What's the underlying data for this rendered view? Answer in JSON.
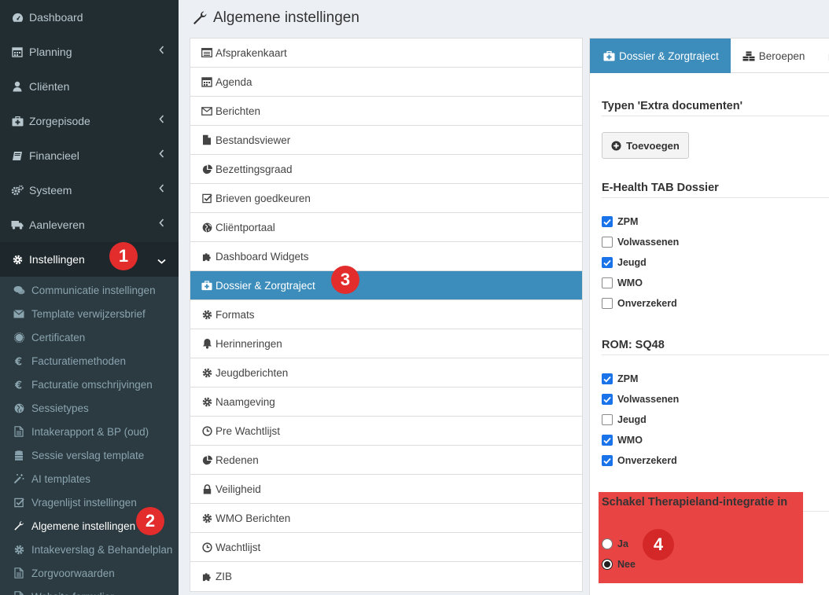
{
  "sidebar": {
    "nav": [
      {
        "label": "Dashboard",
        "icon": "dashboard-icon",
        "chevron": false
      },
      {
        "label": "Planning",
        "icon": "calendar-icon",
        "chevron": true
      },
      {
        "label": "Cliënten",
        "icon": "user-icon",
        "chevron": false
      },
      {
        "label": "Zorgepisode",
        "icon": "medkit-icon",
        "chevron": true
      },
      {
        "label": "Financieel",
        "icon": "book-icon",
        "chevron": true
      },
      {
        "label": "Systeem",
        "icon": "cogs-icon",
        "chevron": true
      },
      {
        "label": "Aanleveren",
        "icon": "truck-icon",
        "chevron": true
      },
      {
        "label": "Instellingen",
        "icon": "gear-icon",
        "chevron": true,
        "active": true
      }
    ],
    "sub": [
      {
        "label": "Communicatie instellingen",
        "icon": "comments-icon"
      },
      {
        "label": "Template verwijzersbrief",
        "icon": "envelope-icon"
      },
      {
        "label": "Certificaten",
        "icon": "certificate-icon"
      },
      {
        "label": "Facturatiemethoden",
        "icon": "euro-icon"
      },
      {
        "label": "Facturatie omschrijvingen",
        "icon": "euro-icon"
      },
      {
        "label": "Sessietypes",
        "icon": "globe-icon"
      },
      {
        "label": "Intakerapport & BP (oud)",
        "icon": "file-icon"
      },
      {
        "label": "Sessie verslag template",
        "icon": "database-icon"
      },
      {
        "label": "AI templates",
        "icon": "magic-wand-icon"
      },
      {
        "label": "Vragenlijst instellingen",
        "icon": "checkbox-icon"
      },
      {
        "label": "Algemene instellingen",
        "icon": "wrench-icon",
        "active": true
      },
      {
        "label": "Intakeverslag & Behandelplan",
        "icon": "gear-icon"
      },
      {
        "label": "Zorgvoorwaarden",
        "icon": "file-icon"
      },
      {
        "label": "Website formulier",
        "icon": "file-icon"
      }
    ]
  },
  "page": {
    "title": "Algemene instellingen"
  },
  "badges": [
    "1",
    "2",
    "3",
    "4"
  ],
  "settings_list": [
    {
      "label": "Afsprakenkaart",
      "icon": "list-alt-icon"
    },
    {
      "label": "Agenda",
      "icon": "calendar-icon"
    },
    {
      "label": "Berichten",
      "icon": "envelope-icon"
    },
    {
      "label": "Bestandsviewer",
      "icon": "file-icon"
    },
    {
      "label": "Bezettingsgraad",
      "icon": "pie-chart-icon"
    },
    {
      "label": "Brieven goedkeuren",
      "icon": "checkbox-icon"
    },
    {
      "label": "Cliëntportaal",
      "icon": "globe-icon"
    },
    {
      "label": "Dashboard Widgets",
      "icon": "puzzle-icon"
    },
    {
      "label": "Dossier & Zorgtraject",
      "icon": "medkit-icon",
      "active": true
    },
    {
      "label": "Formats",
      "icon": "gear-icon"
    },
    {
      "label": "Herinneringen",
      "icon": "bell-icon"
    },
    {
      "label": "Jeugdberichten",
      "icon": "gear-icon"
    },
    {
      "label": "Naamgeving",
      "icon": "gear-icon"
    },
    {
      "label": "Pre Wachtlijst",
      "icon": "clock-icon"
    },
    {
      "label": "Redenen",
      "icon": "pie-chart-icon"
    },
    {
      "label": "Veiligheid",
      "icon": "lock-icon"
    },
    {
      "label": "WMO Berichten",
      "icon": "gear-icon"
    },
    {
      "label": "Wachtlijst",
      "icon": "clock-icon"
    },
    {
      "label": "ZIB",
      "icon": "puzzle-icon"
    }
  ],
  "tabs": [
    {
      "label": "Dossier & Zorgtraject",
      "icon": "medkit-icon",
      "active": true
    },
    {
      "label": "Beroepen",
      "icon": "cubes-icon"
    },
    {
      "label": "",
      "icon": "puzzle-icon"
    }
  ],
  "panel": {
    "extra_docs_title": "Typen 'Extra documenten'",
    "add_button": "Toevoegen",
    "ehealth_title": "E-Health TAB Dossier",
    "ehealth_options": [
      {
        "label": "ZPM",
        "checked": true
      },
      {
        "label": "Volwassenen",
        "checked": false
      },
      {
        "label": "Jeugd",
        "checked": true
      },
      {
        "label": "WMO",
        "checked": false
      },
      {
        "label": "Onverzekerd",
        "checked": false
      }
    ],
    "rom_title": "ROM: SQ48",
    "rom_options": [
      {
        "label": "ZPM",
        "checked": true
      },
      {
        "label": "Volwassenen",
        "checked": true
      },
      {
        "label": "Jeugd",
        "checked": false
      },
      {
        "label": "WMO",
        "checked": true
      },
      {
        "label": "Onverzekerd",
        "checked": true
      }
    ],
    "therapieland_title": "Schakel Therapieland-integratie in",
    "therapieland_options": [
      {
        "label": "Ja",
        "checked": false
      },
      {
        "label": "Nee",
        "checked": true
      }
    ]
  },
  "colors": {
    "sidebar_bg": "#222d32",
    "accent": "#3c8dbc",
    "badge": "#e32c2c",
    "highlight": "#e84444"
  }
}
